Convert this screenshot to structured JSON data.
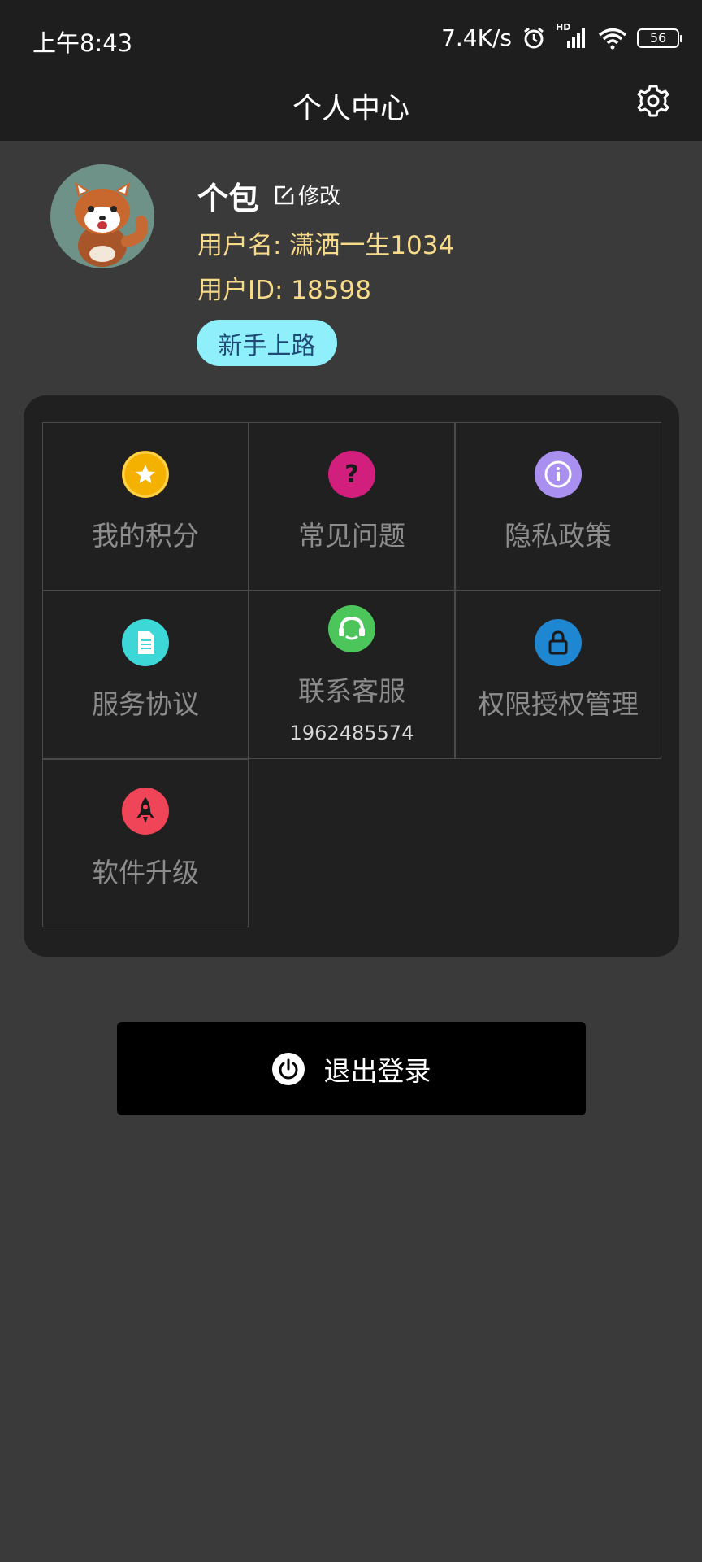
{
  "status_bar": {
    "time": "上午8:43",
    "net_speed": "7.4K/s",
    "signal_tag": "HD",
    "battery": "56"
  },
  "header": {
    "title": "个人中心"
  },
  "profile": {
    "nickname": "个包",
    "edit_label": "修改",
    "username": "用户名: 潇洒一生1034",
    "user_id": "用户ID: 18598",
    "level_badge": "新手上路"
  },
  "menu": {
    "items": [
      {
        "label": "我的积分",
        "icon": "star-icon",
        "color": "#f5b100"
      },
      {
        "label": "常见问题",
        "icon": "question-icon",
        "color": "#d21e7c"
      },
      {
        "label": "隐私政策",
        "icon": "info-icon",
        "color": "#a88ff0"
      },
      {
        "label": "服务协议",
        "icon": "document-icon",
        "color": "#3ed7d8"
      },
      {
        "label": "联系客服",
        "icon": "headset-icon",
        "color": "#4cc65a",
        "sub": "1962485574"
      },
      {
        "label": "权限授权管理",
        "icon": "lock-icon",
        "color": "#1f86d1"
      },
      {
        "label": "软件升级",
        "icon": "rocket-icon",
        "color": "#f04458"
      }
    ]
  },
  "logout": {
    "label": "退出登录",
    "icon": "power-icon"
  }
}
